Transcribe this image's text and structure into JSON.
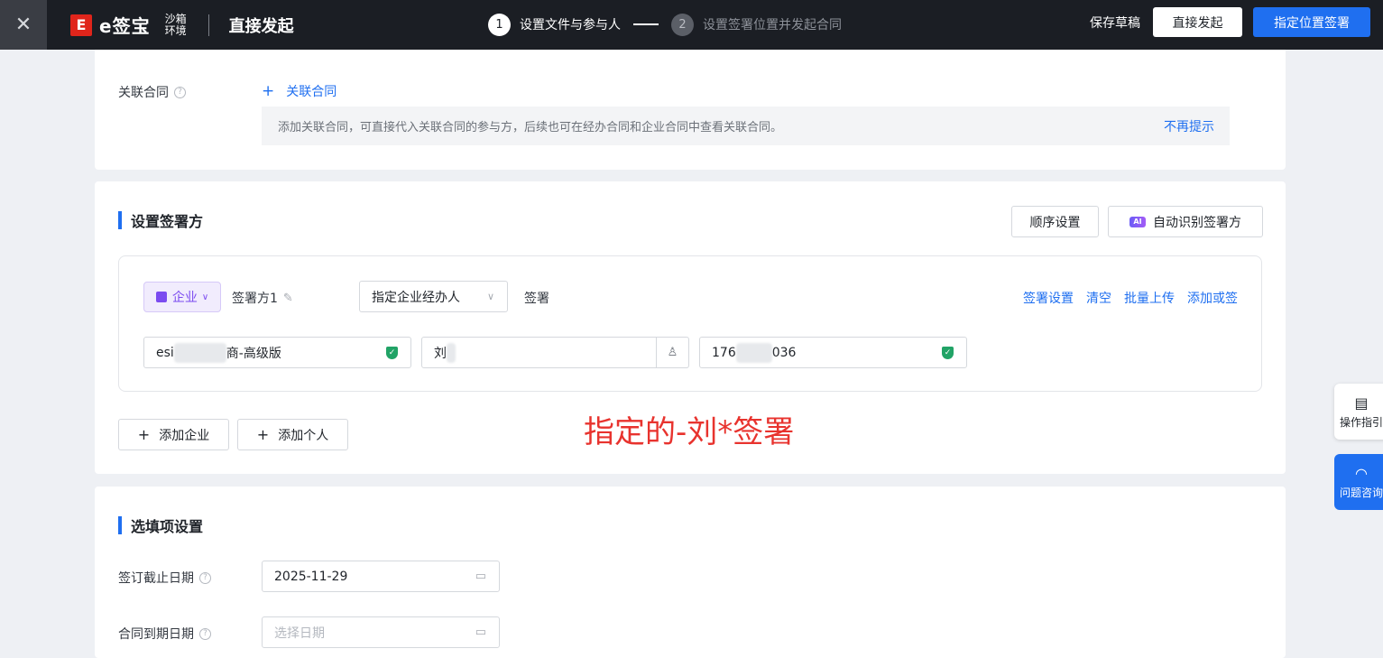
{
  "topbar": {
    "brand": "e签宝",
    "env_line1": "沙箱",
    "env_line2": "环境",
    "title": "直接发起",
    "steps": [
      {
        "num": "1",
        "label": "设置文件与参与人"
      },
      {
        "num": "2",
        "label": "设置签署位置并发起合同"
      }
    ],
    "save_draft": "保存草稿",
    "direct_send": "直接发起",
    "set_position": "指定位置签署"
  },
  "related": {
    "label": "关联合同",
    "add_link": "关联合同",
    "tip": "添加关联合同，可直接代入关联合同的参与方，后续也可在经办合同和企业合同中查看关联合同。",
    "dismiss": "不再提示"
  },
  "signers": {
    "title": "设置签署方",
    "order_button": "顺序设置",
    "ai_badge": "AI",
    "auto_detect_button": "自动识别签署方",
    "party": {
      "type_tag": "企业",
      "name": "签署方1",
      "role_select": "指定企业经办人",
      "sign_type": "签署",
      "actions": [
        "签署设置",
        "清空",
        "批量上传",
        "添加或签"
      ],
      "company_prefix": "esi",
      "company_suffix": "商-高级版",
      "person_prefix": "刘",
      "phone_prefix": "176",
      "phone_suffix": "036"
    },
    "add_company": "添加企业",
    "add_person": "添加个人",
    "annotation": "指定的-刘*签署"
  },
  "optional": {
    "title": "选填项设置",
    "deadline_label": "签订截止日期",
    "deadline_value": "2025-11-29",
    "expire_label": "合同到期日期",
    "expire_placeholder": "选择日期"
  },
  "side": {
    "guide": "操作指引",
    "help": "问题咨询"
  }
}
